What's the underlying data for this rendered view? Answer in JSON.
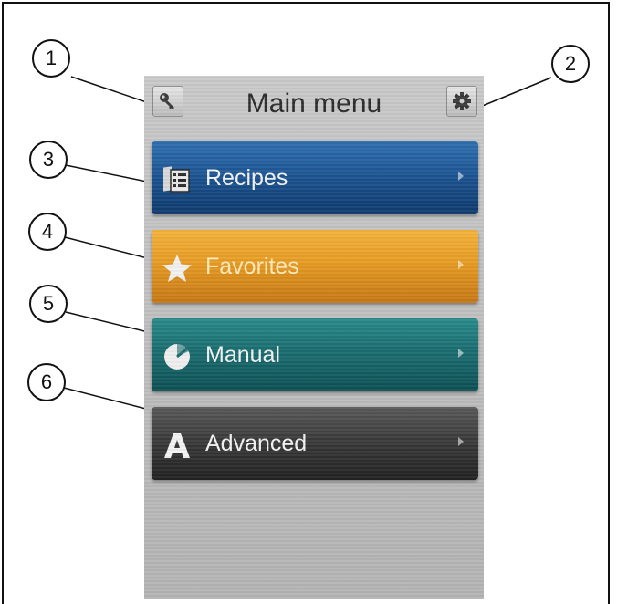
{
  "header": {
    "title": "Main menu",
    "left_icon": "key-icon",
    "right_icon": "gear-icon"
  },
  "menu": {
    "items": [
      {
        "label": "Recipes",
        "icon": "recipe-book-icon",
        "color": "#1d5593"
      },
      {
        "label": "Favorites",
        "icon": "star-icon",
        "color": "#e79c24"
      },
      {
        "label": "Manual",
        "icon": "dial-icon",
        "color": "#1a6d70"
      },
      {
        "label": "Advanced",
        "icon": "letter-a-icon",
        "color": "#3a3a3a"
      }
    ]
  },
  "callouts": [
    "1",
    "2",
    "3",
    "4",
    "5",
    "6"
  ]
}
